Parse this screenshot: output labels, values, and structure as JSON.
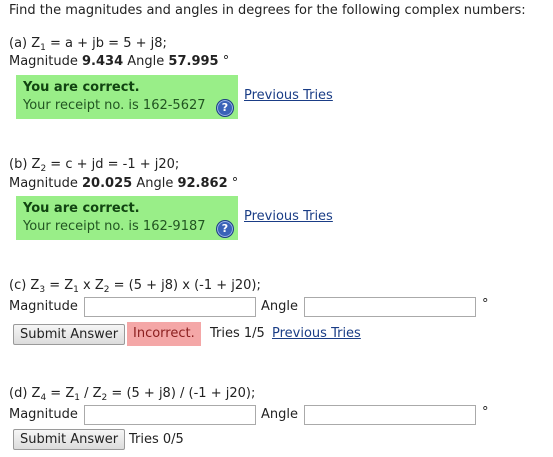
{
  "instructions": "Find the magnitudes and angles in degrees for the following complex numbers:",
  "parts": {
    "a": {
      "prefix": "(a) Z",
      "sub": "1",
      "expr": " = a + jb = 5 + j8;",
      "mag_label": "Magnitude",
      "mag_value": "9.434",
      "angle_label": "Angle",
      "angle_value": "57.995",
      "deg": "°",
      "status_title": "You are correct.",
      "receipt": "Your receipt no. is 162-5627",
      "previous_tries": "Previous Tries"
    },
    "b": {
      "prefix": "(b) Z",
      "sub": "2",
      "expr": " = c + jd = -1 + j20;",
      "mag_label": "Magnitude",
      "mag_value": "20.025",
      "angle_label": "Angle",
      "angle_value": "92.862",
      "deg": "°",
      "status_title": "You are correct.",
      "receipt": "Your receipt no. is 162-9187",
      "previous_tries": "Previous Tries"
    },
    "c": {
      "prefix": "(c) Z",
      "sub": "3",
      "expr_mid1": " = Z",
      "sub2": "1",
      "expr_mid2": " x Z",
      "sub3": "2",
      "expr_end": " = (5 + j8) x (-1 + j20);",
      "mag_label": "Magnitude",
      "angle_label": "Angle",
      "deg": "°",
      "submit": "Submit Answer",
      "status": "Incorrect.",
      "tries": "Tries 1/5",
      "previous_tries": "Previous Tries"
    },
    "d": {
      "prefix": "(d) Z",
      "sub": "4",
      "expr_mid1": " = Z",
      "sub2": "1",
      "expr_mid2": " / Z",
      "sub3": "2",
      "expr_end": " = (5 + j8) / (-1 + j20);",
      "mag_label": "Magnitude",
      "angle_label": "Angle",
      "deg": "°",
      "submit": "Submit Answer",
      "tries": "Tries 0/5"
    }
  },
  "icons": {
    "help": "?"
  },
  "colors": {
    "correct_bg": "#99ee88",
    "incorrect_bg": "#f4a7a7",
    "link": "#1a3d86"
  }
}
